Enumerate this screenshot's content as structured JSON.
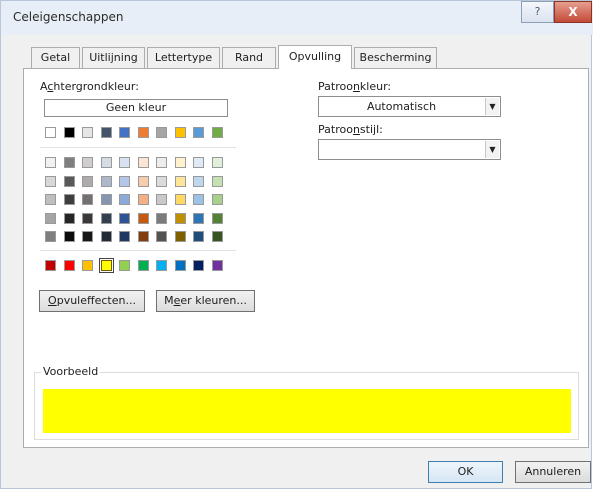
{
  "window": {
    "title": "Celeigenschappen",
    "help_label": "?",
    "close_label": "X"
  },
  "tabs": [
    {
      "label": "Getal",
      "active": false
    },
    {
      "label": "Uitlijning",
      "active": false
    },
    {
      "label": "Lettertype",
      "active": false
    },
    {
      "label": "Rand",
      "active": false
    },
    {
      "label": "Opvulling",
      "active": true
    },
    {
      "label": "Bescherming",
      "active": false
    }
  ],
  "fill": {
    "background_label": "Achtergrondkleur:",
    "no_color_label": "Geen kleur",
    "theme_colors": [
      "#ffffff",
      "#000000",
      "#e7e6e6",
      "#44546a",
      "#4472c4",
      "#ed7d31",
      "#a5a5a5",
      "#ffc000",
      "#5b9bd5",
      "#70ad47"
    ],
    "tint_rows": [
      [
        "#f2f2f2",
        "#7f7f7f",
        "#d0cece",
        "#d6dce4",
        "#d9e2f3",
        "#fbe5d5",
        "#ededed",
        "#fff2cc",
        "#deebf6",
        "#e2efd9"
      ],
      [
        "#d8d8d8",
        "#595959",
        "#aeabab",
        "#adb9ca",
        "#b4c6e7",
        "#f7cbac",
        "#dbdbdb",
        "#fee599",
        "#bdd7ee",
        "#c5e0b3"
      ],
      [
        "#bfbfbf",
        "#3f3f3f",
        "#757070",
        "#8496b0",
        "#8eaadb",
        "#f4b083",
        "#c9c9c9",
        "#ffd966",
        "#9cc3e5",
        "#a8d08d"
      ],
      [
        "#a5a5a5",
        "#262626",
        "#3a3838",
        "#323f4f",
        "#2f5496",
        "#c55a11",
        "#7b7b7b",
        "#bf8f00",
        "#2e75b5",
        "#538135"
      ],
      [
        "#7f7f7f",
        "#0c0c0c",
        "#171616",
        "#222a35",
        "#1f3864",
        "#833c0b",
        "#525252",
        "#7f6000",
        "#1e4e79",
        "#375623"
      ]
    ],
    "standard_colors": [
      "#c00000",
      "#ff0000",
      "#ffc000",
      "#ffff00",
      "#92d050",
      "#00b050",
      "#00b0f0",
      "#0070c0",
      "#002060",
      "#7030a0"
    ],
    "selected_color": "#ffff00",
    "fill_effects_label": "Opvuleffecten...",
    "more_colors_label": "Meer kleuren..."
  },
  "pattern": {
    "color_label": "Patroonkleur:",
    "color_value": "Automatisch",
    "style_label": "Patroonstijl:",
    "style_value": ""
  },
  "sample": {
    "label": "Voorbeeld",
    "color": "#ffff00"
  },
  "footer": {
    "ok_label": "OK",
    "cancel_label": "Annuleren"
  }
}
